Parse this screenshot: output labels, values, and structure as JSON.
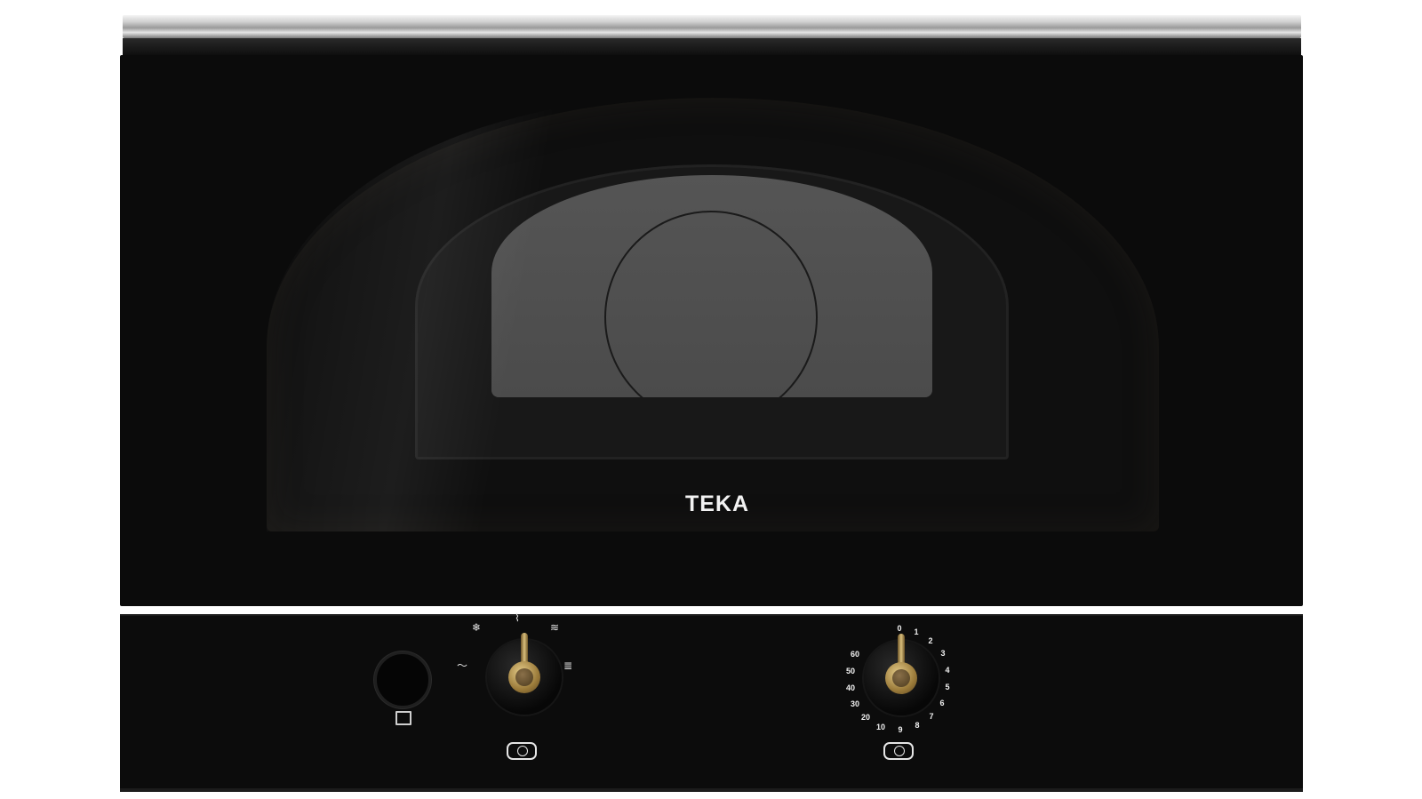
{
  "brand": {
    "logo_text": "TEKA"
  },
  "timer_dial": {
    "labels": [
      "0",
      "1",
      "2",
      "3",
      "4",
      "5",
      "6",
      "7",
      "8",
      "9",
      "10",
      "20",
      "30",
      "40",
      "50",
      "60"
    ]
  },
  "function_dial": {
    "modes": [
      {
        "icon": "defrost-icon"
      },
      {
        "icon": "microwave-power-icon"
      },
      {
        "icon": "grill-icon"
      },
      {
        "icon": "combi-grill-icon"
      },
      {
        "icon": "off-wave-icon"
      }
    ]
  },
  "colors": {
    "body": "#0b0b0b",
    "chrome": "#c8c8c8",
    "knob_brass": "#b8975a",
    "glass": "#4f4f4f"
  }
}
